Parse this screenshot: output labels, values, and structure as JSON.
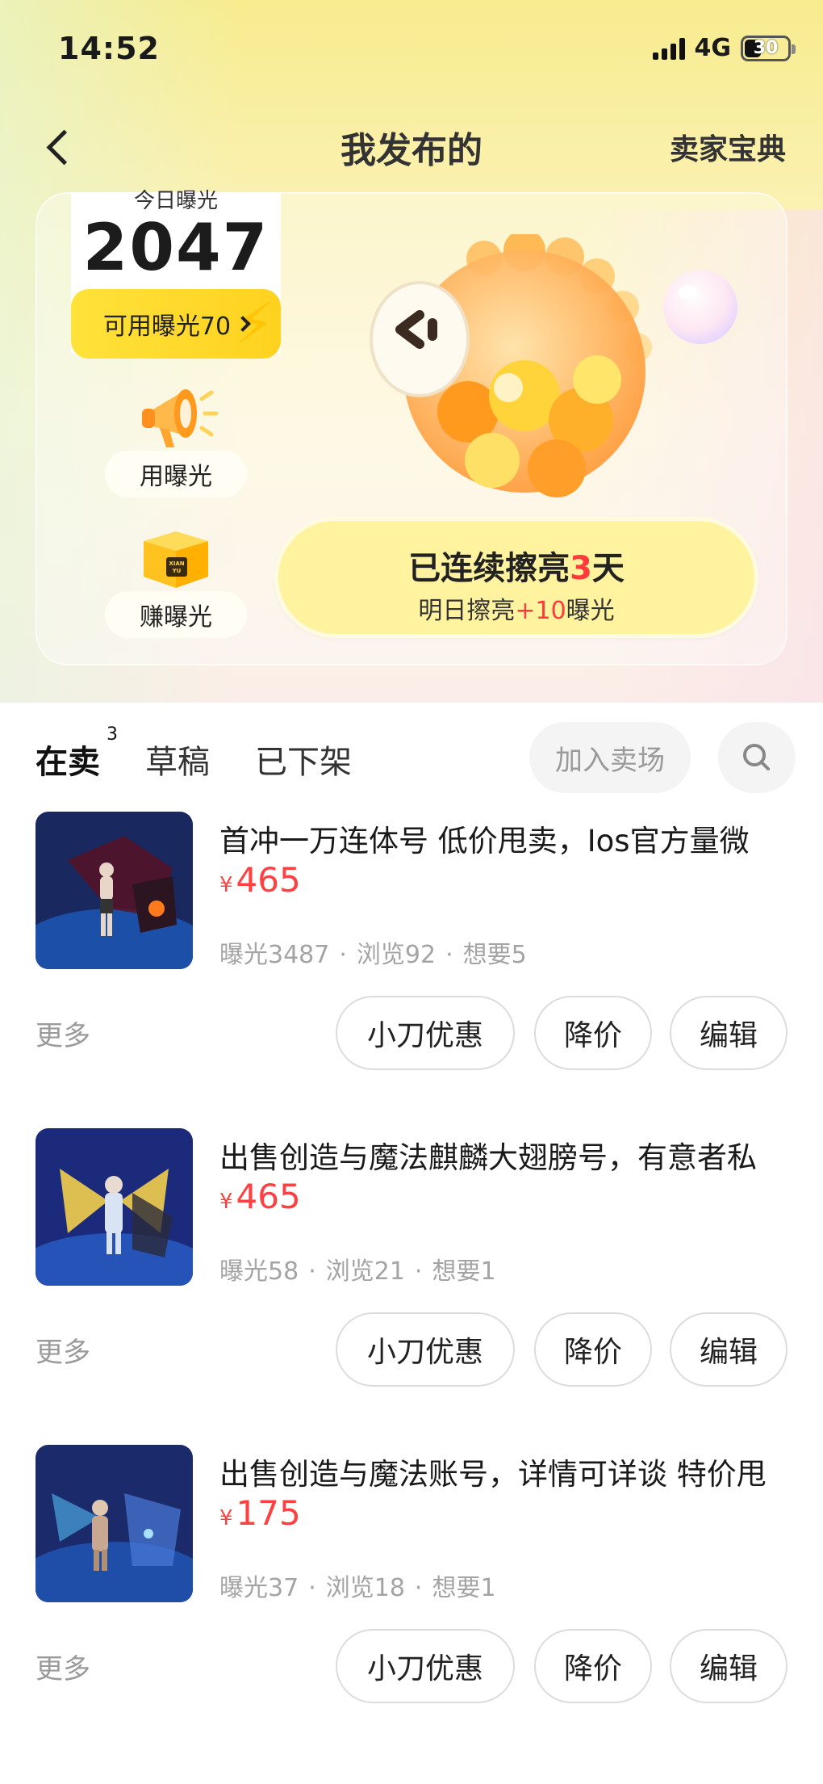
{
  "status_bar": {
    "time": "14:52",
    "network": "4G",
    "battery": "30"
  },
  "nav": {
    "title": "我发布的",
    "right_link": "卖家宝典"
  },
  "stats": {
    "exposure_label": "今日曝光",
    "exposure_value": "2047",
    "available_label": "可用曝光70",
    "use_exposure": "用曝光",
    "earn_exposure": "赚曝光",
    "earn_icon_text": "XIAN YU",
    "streak_prefix": "已连续擦亮",
    "streak_days": "3",
    "streak_suffix": "天",
    "tomorrow_prefix": "明日擦亮",
    "tomorrow_bonus": "+10",
    "tomorrow_suffix": "曝光"
  },
  "tabs": [
    {
      "label": "在卖",
      "count": "3",
      "active": true
    },
    {
      "label": "草稿"
    },
    {
      "label": "已下架"
    }
  ],
  "join_button": "加入卖场",
  "items": [
    {
      "title": "首冲一万连体号 低价甩卖，Ios官方量微",
      "currency": "¥",
      "price": "465",
      "exposure": "曝光3487",
      "views": "浏览92",
      "wants": "想要5"
    },
    {
      "title": "出售创造与魔法麒麟大翅膀号，有意者私",
      "currency": "¥",
      "price": "465",
      "exposure": "曝光58",
      "views": "浏览21",
      "wants": "想要1"
    },
    {
      "title": "出售创造与魔法账号，详情可详谈 特价甩",
      "currency": "¥",
      "price": "175",
      "exposure": "曝光37",
      "views": "浏览18",
      "wants": "想要1"
    }
  ],
  "item_actions": {
    "more": "更多",
    "discount": "小刀优惠",
    "reduce": "降价",
    "edit": "编辑"
  },
  "colors": {
    "accent_yellow": "#ffe23a",
    "price_red": "#ff4040",
    "stats_gray": "#a4a4a4"
  }
}
